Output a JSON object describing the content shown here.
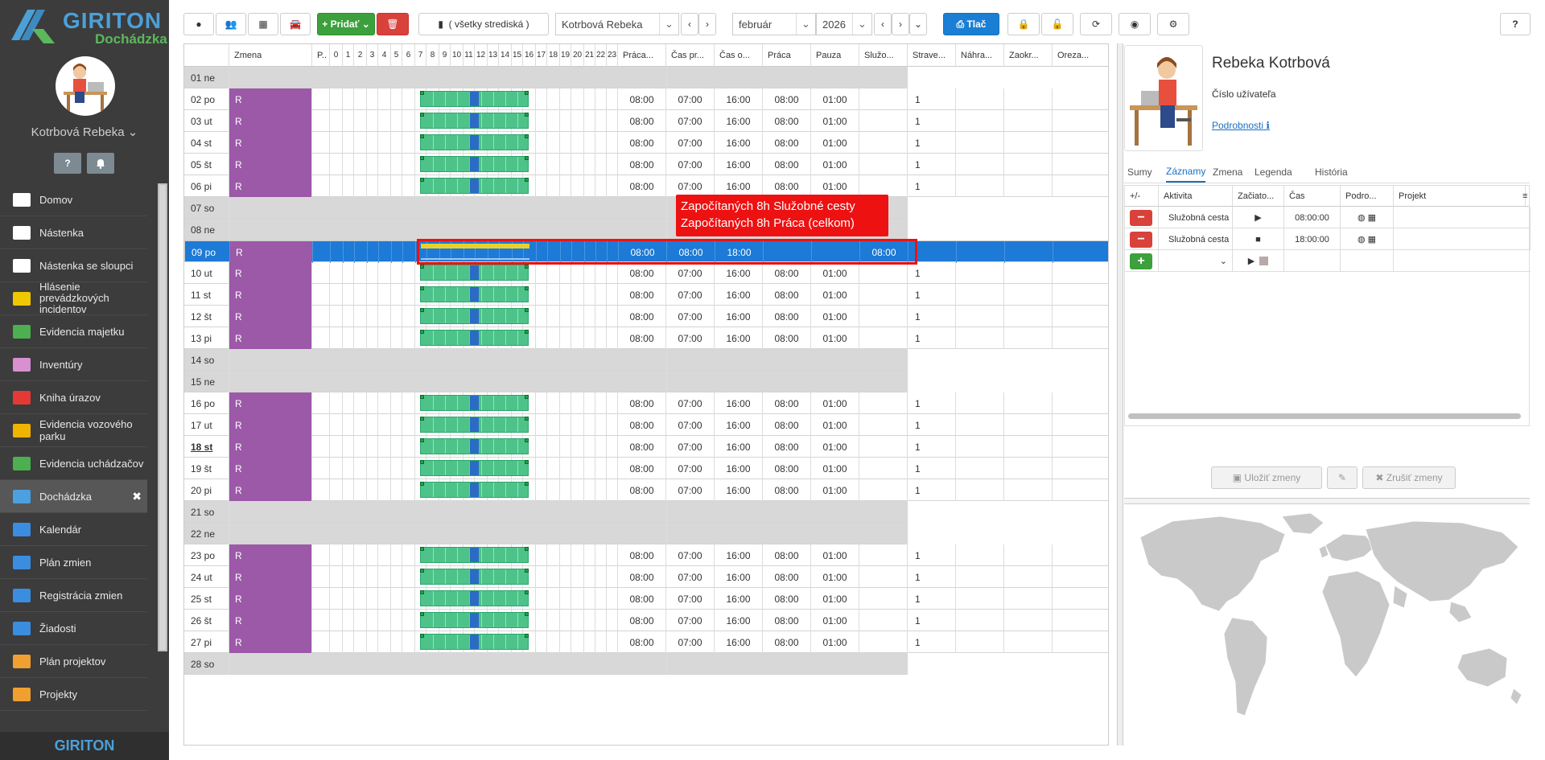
{
  "sidebar": {
    "brand": "GIRITON",
    "product": "Dochádzka",
    "user_name": "Kotrbová Rebeka",
    "help_label": "?",
    "items": [
      {
        "label": "Domov",
        "icon": "home-icon"
      },
      {
        "label": "Nástenka",
        "icon": "bank-icon"
      },
      {
        "label": "Nástenka se sloupci",
        "icon": "columns-icon"
      },
      {
        "label": "Hlásenie prevádzkových incidentov",
        "icon": "megaphone-icon"
      },
      {
        "label": "Evidencia majetku",
        "icon": "box-icon"
      },
      {
        "label": "Inventúry",
        "icon": "circle-icon"
      },
      {
        "label": "Kniha úrazov",
        "icon": "ambulance-icon"
      },
      {
        "label": "Evidencia vozového parku",
        "icon": "car-icon"
      },
      {
        "label": "Evidencia uchádzačov",
        "icon": "user-plus-icon"
      },
      {
        "label": "Dochádzka",
        "icon": "user-icon"
      },
      {
        "label": "Kalendár",
        "icon": "calendar-icon"
      },
      {
        "label": "Plán zmien",
        "icon": "calendar-grid-icon"
      },
      {
        "label": "Registrácia zmien",
        "icon": "calendar-check-icon"
      },
      {
        "label": "Žiadosti",
        "icon": "gavel-icon"
      },
      {
        "label": "Plán projektov",
        "icon": "calendar-orange-icon"
      },
      {
        "label": "Projekty",
        "icon": "calendar-orange-icon"
      }
    ],
    "close_label": "✖",
    "footer_brand": "GIRITON"
  },
  "toolbar": {
    "add_label": "Pridať",
    "centers_label": "( všetky strediská )",
    "employee": "Kotrbová Rebeka",
    "month": "február",
    "year": "2026",
    "print_label": "Tlač",
    "help_label": "?"
  },
  "grid": {
    "headers": [
      "Zmena",
      "P..",
      "Práca...",
      "Čas pr...",
      "Čas o...",
      "Práca",
      "Pauza",
      "Služo...",
      "Strave...",
      "Náhra...",
      "Zaokr...",
      "Oreza..."
    ],
    "hours": [
      "0",
      "1",
      "2",
      "3",
      "4",
      "5",
      "6",
      "7",
      "8",
      "9",
      "10",
      "11",
      "12",
      "13",
      "14",
      "15",
      "16",
      "17",
      "18",
      "19",
      "20",
      "21",
      "22",
      "23"
    ],
    "rows": [
      {
        "date": "01 ne",
        "weekend": true
      },
      {
        "date": "02 po",
        "shift": "R",
        "a": "08:00",
        "b": "07:00",
        "c": "16:00",
        "d": "08:00",
        "e": "01:00",
        "m": "1"
      },
      {
        "date": "03 ut",
        "shift": "R",
        "a": "08:00",
        "b": "07:00",
        "c": "16:00",
        "d": "08:00",
        "e": "01:00",
        "m": "1"
      },
      {
        "date": "04 st",
        "shift": "R",
        "a": "08:00",
        "b": "07:00",
        "c": "16:00",
        "d": "08:00",
        "e": "01:00",
        "m": "1"
      },
      {
        "date": "05 št",
        "shift": "R",
        "a": "08:00",
        "b": "07:00",
        "c": "16:00",
        "d": "08:00",
        "e": "01:00",
        "m": "1"
      },
      {
        "date": "06 pi",
        "shift": "R",
        "a": "08:00",
        "b": "07:00",
        "c": "16:00",
        "d": "08:00",
        "e": "01:00",
        "m": "1"
      },
      {
        "date": "07 so",
        "weekend": true
      },
      {
        "date": "08 ne",
        "weekend": true
      },
      {
        "date": "09 po",
        "shift": "R",
        "a": "08:00",
        "b": "08:00",
        "c": "18:00",
        "f": "08:00",
        "selected": true
      },
      {
        "date": "10 ut",
        "shift": "R",
        "a": "08:00",
        "b": "07:00",
        "c": "16:00",
        "d": "08:00",
        "e": "01:00",
        "m": "1"
      },
      {
        "date": "11 st",
        "shift": "R",
        "a": "08:00",
        "b": "07:00",
        "c": "16:00",
        "d": "08:00",
        "e": "01:00",
        "m": "1"
      },
      {
        "date": "12 št",
        "shift": "R",
        "a": "08:00",
        "b": "07:00",
        "c": "16:00",
        "d": "08:00",
        "e": "01:00",
        "m": "1"
      },
      {
        "date": "13 pi",
        "shift": "R",
        "a": "08:00",
        "b": "07:00",
        "c": "16:00",
        "d": "08:00",
        "e": "01:00",
        "m": "1"
      },
      {
        "date": "14 so",
        "weekend": true
      },
      {
        "date": "15 ne",
        "weekend": true
      },
      {
        "date": "16 po",
        "shift": "R",
        "a": "08:00",
        "b": "07:00",
        "c": "16:00",
        "d": "08:00",
        "e": "01:00",
        "m": "1"
      },
      {
        "date": "17 ut",
        "shift": "R",
        "a": "08:00",
        "b": "07:00",
        "c": "16:00",
        "d": "08:00",
        "e": "01:00",
        "m": "1"
      },
      {
        "date": "18 st",
        "shift": "R",
        "a": "08:00",
        "b": "07:00",
        "c": "16:00",
        "d": "08:00",
        "e": "01:00",
        "m": "1",
        "today": true
      },
      {
        "date": "19 št",
        "shift": "R",
        "a": "08:00",
        "b": "07:00",
        "c": "16:00",
        "d": "08:00",
        "e": "01:00",
        "m": "1"
      },
      {
        "date": "20 pi",
        "shift": "R",
        "a": "08:00",
        "b": "07:00",
        "c": "16:00",
        "d": "08:00",
        "e": "01:00",
        "m": "1"
      },
      {
        "date": "21 so",
        "weekend": true
      },
      {
        "date": "22 ne",
        "weekend": true
      },
      {
        "date": "23 po",
        "shift": "R",
        "a": "08:00",
        "b": "07:00",
        "c": "16:00",
        "d": "08:00",
        "e": "01:00",
        "m": "1"
      },
      {
        "date": "24 ut",
        "shift": "R",
        "a": "08:00",
        "b": "07:00",
        "c": "16:00",
        "d": "08:00",
        "e": "01:00",
        "m": "1"
      },
      {
        "date": "25 st",
        "shift": "R",
        "a": "08:00",
        "b": "07:00",
        "c": "16:00",
        "d": "08:00",
        "e": "01:00",
        "m": "1"
      },
      {
        "date": "26 št",
        "shift": "R",
        "a": "08:00",
        "b": "07:00",
        "c": "16:00",
        "d": "08:00",
        "e": "01:00",
        "m": "1"
      },
      {
        "date": "27 pi",
        "shift": "R",
        "a": "08:00",
        "b": "07:00",
        "c": "16:00",
        "d": "08:00",
        "e": "01:00",
        "m": "1"
      },
      {
        "date": "28 so",
        "weekend": true
      }
    ],
    "tooltip_line1": "Započítaných 8h Služobné cesty",
    "tooltip_line2": "Započítaných 8h Práca (celkom)"
  },
  "profile": {
    "name": "Rebeka Kotrbová",
    "uid_label": "Číslo užívateľa",
    "details_label": "Podrobnosti",
    "tabs": [
      "Sumy",
      "Záznamy",
      "Zmena",
      "Legenda",
      "História"
    ],
    "active_tab": "Záznamy"
  },
  "records": {
    "headers": [
      "+/-",
      "Aktivita",
      "Začiato...",
      "Čas",
      "Podro...",
      "Projekt"
    ],
    "rows": [
      {
        "activity": "Služobná cesta",
        "time": "08:00:00"
      },
      {
        "activity": "Služobná cesta",
        "time": "18:00:00"
      }
    ],
    "save_label": "Uložiť zmeny",
    "cancel_label": "Zrušiť zmeny"
  },
  "colors": {
    "shift": "#9b59a8",
    "selected": "#1d7ad6",
    "work_bar": "#4dc38a",
    "accent": "#1a7fd4",
    "tooltip": "#e11111"
  }
}
